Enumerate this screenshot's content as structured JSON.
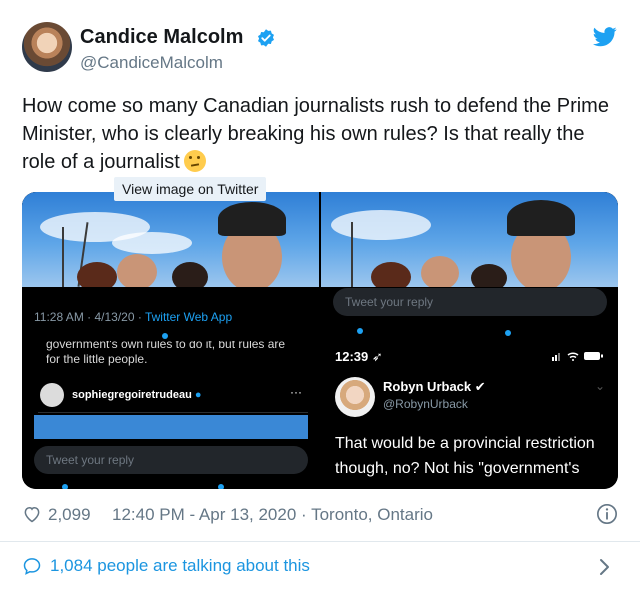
{
  "author": {
    "display_name": "Candice Malcolm",
    "handle": "@CandiceMalcolm"
  },
  "tweet": {
    "text": "How come so many Canadian journalists rush to defend the Prime Minister, who is clearly breaking his own rules? Is that really the role of a journalist"
  },
  "tooltip": "View image on Twitter",
  "media": {
    "tile1": {
      "time": "11:28 AM · 4/13/20 · ",
      "app": "Twitter Web App"
    },
    "tile2": {
      "reply_placeholder": "Tweet your reply"
    },
    "tile3": {
      "quoted_text": "government's own rules to do it, but rules are\nfor the little people.",
      "username": "sophiegregoiretrudeau",
      "more": "···",
      "reply_placeholder": "Tweet your reply"
    },
    "tile4": {
      "status_time": "12:39",
      "name": "Robyn Urback",
      "handle": "@RobynUrback",
      "text": "That would be a provincial restriction though, no? Not his \"government's"
    }
  },
  "stats": {
    "likes": "2,099",
    "timestamp": "12:40 PM - Apr 13, 2020 · Toronto, Ontario"
  },
  "footer": {
    "talking": "1,084 people are talking about this"
  },
  "colors": {
    "accent": "#1da1f2",
    "link": "#1b95e0",
    "muted": "#657786"
  }
}
